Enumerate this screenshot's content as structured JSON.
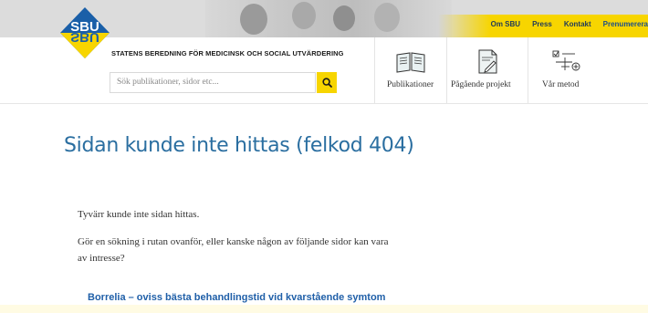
{
  "brand": {
    "logo_text": "SBU",
    "tagline": "STATENS BEREDNING FÖR MEDICINSK OCH SOCIAL UTVÄRDERING",
    "accent_yellow": "#f7d500",
    "accent_blue": "#1a5fa8"
  },
  "top_links": [
    {
      "label": "Om SBU"
    },
    {
      "label": "Press"
    },
    {
      "label": "Kontakt"
    },
    {
      "label": "Prenumerera"
    }
  ],
  "search": {
    "placeholder": "Sök publikationer, sidor etc...",
    "value": "",
    "button_icon": "search-icon"
  },
  "nav": [
    {
      "label": "Publikationer",
      "icon": "book-icon"
    },
    {
      "label": "Pågående projekt",
      "icon": "document-edit-icon"
    },
    {
      "label": "Vår metod",
      "icon": "method-icon"
    }
  ],
  "main": {
    "title": "Sidan kunde inte hittas (felkod 404)",
    "paragraph_1": "Tyvärr kunde inte sidan hittas.",
    "paragraph_2_line_1": "Gör en sökning i rutan ovanför, eller kanske någon av följande sidor kan vara",
    "paragraph_2_line_2": "av intresse?",
    "suggested_link": "Borrelia – oviss bästa behandlingstid vid kvarstående symtom"
  }
}
